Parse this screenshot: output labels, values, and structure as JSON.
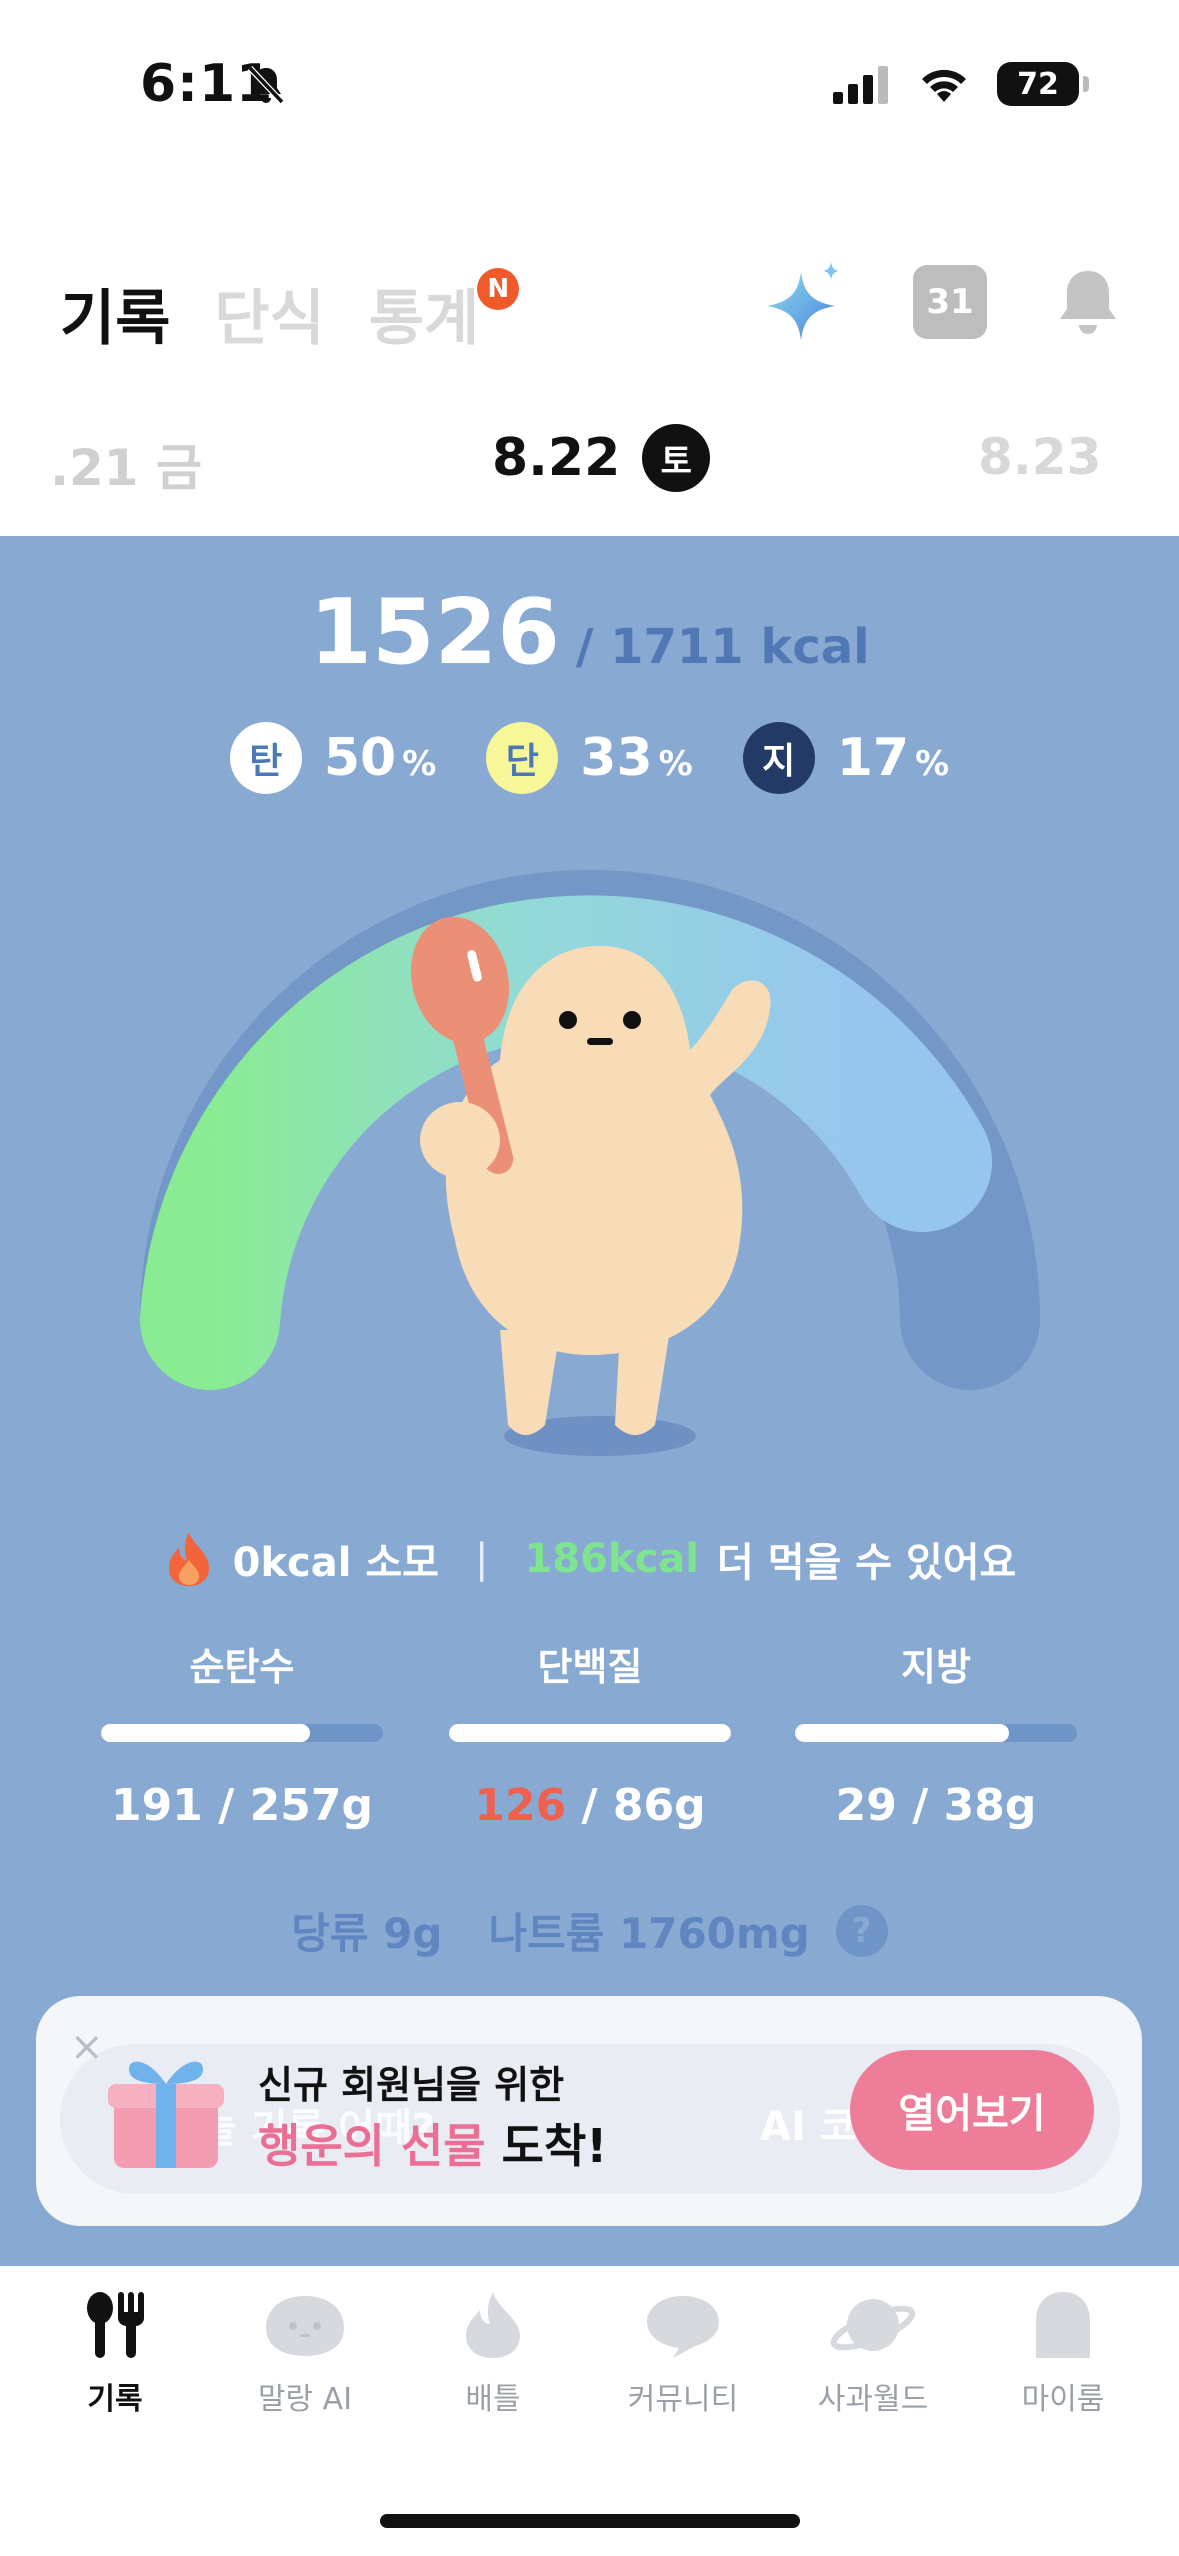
{
  "status": {
    "time": "6:11",
    "battery": "72"
  },
  "header": {
    "tabs": [
      {
        "label": "기록",
        "active": true
      },
      {
        "label": "단식",
        "active": false
      },
      {
        "label": "통계",
        "active": false,
        "badge": "N"
      }
    ],
    "calendar_day": "31",
    "icons": [
      "sparkle-ai-icon",
      "calendar-icon",
      "bell-icon"
    ]
  },
  "date": {
    "prev": ".21 금",
    "current": "8.22",
    "current_day": "토",
    "next": "8.23"
  },
  "summary": {
    "kcal_current": "1526",
    "kcal_goal": "/ 1711 kcal",
    "macros": [
      {
        "symbol": "탄",
        "pct": "50",
        "unit": "%",
        "color": "#ffffff",
        "text_color": "#4d78b8"
      },
      {
        "symbol": "단",
        "pct": "33",
        "unit": "%",
        "color": "#f7f79a",
        "text_color": "#4d78b8"
      },
      {
        "symbol": "지",
        "pct": "17",
        "unit": "%",
        "color": "#233a66",
        "text_color": "#ffffff"
      }
    ]
  },
  "burn": {
    "burned": "0kcal 소모",
    "remaining": "186kcal",
    "remaining_suffix": "더 먹을 수 있어요"
  },
  "nutrients": [
    {
      "label": "순탄수",
      "fill": 0.74,
      "current": "191",
      "goal": "/ 257g",
      "over": false
    },
    {
      "label": "단백질",
      "fill": 1.0,
      "current": "126",
      "goal": "/ 86g",
      "over": true
    },
    {
      "label": "지방",
      "fill": 0.76,
      "current": "29",
      "goal": "/ 38g",
      "over": false
    }
  ],
  "extra": {
    "sugar": "당류 9g",
    "sodium": "나트륨 1760mg",
    "help": "?"
  },
  "promo": {
    "ghost_left": "늘 기록 어때?",
    "ghost_right": "AI 코",
    "line1": "신규 회원님을 위한",
    "line2_highlight": "행운의 선물",
    "line2_rest": " 도착!",
    "button": "열어보기",
    "close": "×"
  },
  "nav": [
    {
      "label": "기록",
      "icon": "fork-knife-icon",
      "active": true
    },
    {
      "label": "말랑 AI",
      "icon": "character-face-icon",
      "active": false
    },
    {
      "label": "배틀",
      "icon": "flame-icon",
      "active": false
    },
    {
      "label": "커뮤니티",
      "icon": "chat-bubble-icon",
      "active": false
    },
    {
      "label": "사과월드",
      "icon": "planet-icon",
      "active": false
    },
    {
      "label": "마이룸",
      "icon": "ghost-room-icon",
      "active": false
    }
  ]
}
